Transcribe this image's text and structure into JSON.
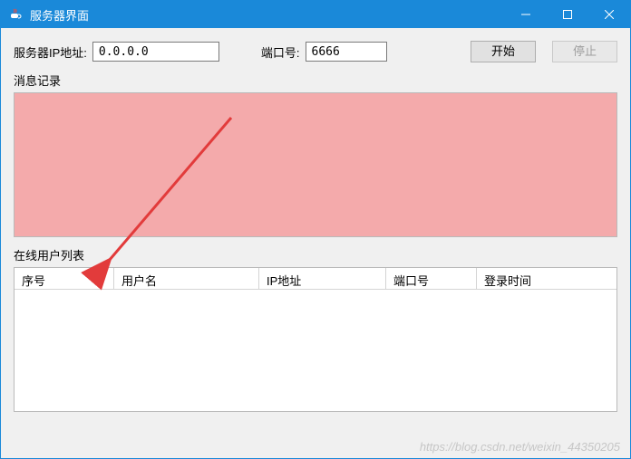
{
  "window": {
    "title": "服务器界面"
  },
  "form": {
    "ip_label": "服务器IP地址:",
    "ip_value": "0.0.0.0",
    "port_label": "端口号:",
    "port_value": "6666",
    "start_label": "开始",
    "stop_label": "停止"
  },
  "log": {
    "title": "消息记录"
  },
  "user_list": {
    "title": "在线用户列表",
    "columns": {
      "c0": "序号",
      "c1": "用户名",
      "c2": "IP地址",
      "c3": "端口号",
      "c4": "登录时间"
    }
  },
  "watermark": "https://blog.csdn.net/weixin_44350205"
}
